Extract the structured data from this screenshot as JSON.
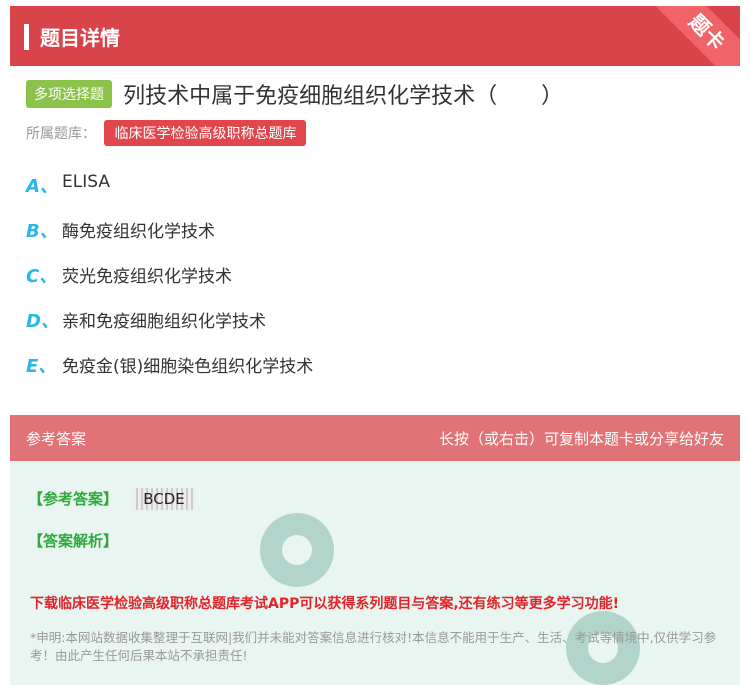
{
  "header": {
    "title": "题目详情",
    "corner": "题卡"
  },
  "question": {
    "type_badge": "多项选择题",
    "text": "列技术中属于免疫细胞组织化学技术（　　）"
  },
  "bank": {
    "label": "所属题库：",
    "name": "临床医学检验高级职称总题库"
  },
  "options": [
    {
      "letter": "A、",
      "text": "ELISA"
    },
    {
      "letter": "B、",
      "text": "酶免疫组织化学技术"
    },
    {
      "letter": "C、",
      "text": "荧光免疫组织化学技术"
    },
    {
      "letter": "D、",
      "text": "亲和免疫细胞组织化学技术"
    },
    {
      "letter": "E、",
      "text": "免疫金(银)细胞染色组织化学技术"
    }
  ],
  "answer": {
    "head_left": "参考答案",
    "head_right": "长按（或右击）可复制本题卡或分享给好友",
    "answer_label": "【参考答案】",
    "answer_value": "BCDE",
    "analysis_label": "【答案解析】",
    "promo": "下载临床医学检验高级职称总题库考试APP可以获得系列题目与答案,还有练习等更多学习功能!",
    "disclaimer": "*申明:本网站数据收集整理于互联网|我们并未能对答案信息进行核对!本信息不能用于生产、生活、考试等情境中,仅供学习参考！由此产生任何后果本站不承担责任!"
  },
  "colors": {
    "header_bg": "#d9434a",
    "option_letter": "#29b6e8",
    "answer_green": "#2eaa3c",
    "promo_red": "#e0252b"
  }
}
